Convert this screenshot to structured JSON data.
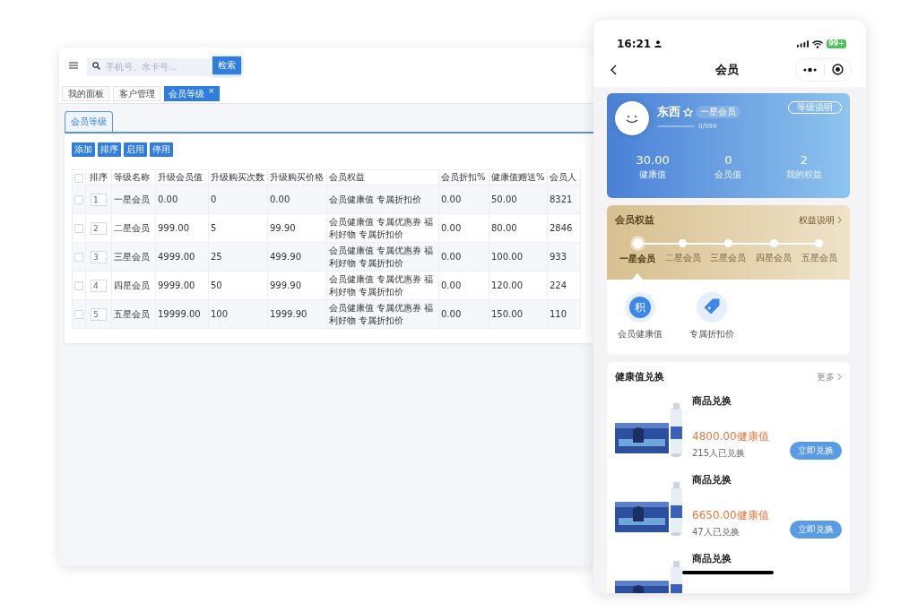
{
  "admin": {
    "search": {
      "placeholder": "手机号、水卡号...",
      "button": "检索"
    },
    "tabs": [
      {
        "label": "我的面板",
        "selected": false
      },
      {
        "label": "客户管理",
        "selected": false
      },
      {
        "label": "会员等级",
        "selected": true,
        "close": "×"
      }
    ],
    "sub_tabs": [
      {
        "label": "会员等级",
        "selected": true
      }
    ],
    "toolbar": [
      "添加",
      "排序",
      "启用",
      "停用"
    ],
    "table": {
      "header_checked": false,
      "columns": [
        "排序",
        "等级名称",
        "升级会员值",
        "升级购买次数",
        "升级购买价格",
        "会员权益",
        "会员折扣%",
        "健康值赠送%",
        "会员人"
      ],
      "rows": [
        {
          "checked": false,
          "cells": [
            "1",
            "一星会员",
            "0.00",
            "0",
            "0.00",
            "会员健康值 专属折扣价",
            "0.00",
            "50.00",
            "8321"
          ]
        },
        {
          "checked": false,
          "cells": [
            "2",
            "二星会员",
            "999.00",
            "5",
            "99.90",
            "会员健康值 专属优惠券 福利好物 专属折扣价",
            "0.00",
            "80.00",
            "2846"
          ]
        },
        {
          "checked": false,
          "cells": [
            "3",
            "三星会员",
            "4999.00",
            "25",
            "499.90",
            "会员健康值 专属优惠券 福利好物 专属折扣价",
            "0.00",
            "100.00",
            "933"
          ]
        },
        {
          "checked": false,
          "cells": [
            "4",
            "四星会员",
            "9999.00",
            "50",
            "999.90",
            "会员健康值 专属优惠券 福利好物 专属折扣价",
            "0.00",
            "120.00",
            "224"
          ]
        },
        {
          "checked": false,
          "cells": [
            "5",
            "五星会员",
            "19999.00",
            "100",
            "1999.90",
            "会员健康值 专属优惠券 福利好物 专属折扣价",
            "0.00",
            "150.00",
            "110"
          ]
        }
      ]
    }
  },
  "phone": {
    "status_bar": {
      "time": "16:21",
      "battery": "99+"
    },
    "nav": {
      "title": "会员"
    },
    "member_card": {
      "name": "东西",
      "badge": "一星会员",
      "progress": {
        "level": 0,
        "text": "0/999"
      },
      "button": "等级说明",
      "stats": [
        {
          "value": "30.00",
          "label": "健康值"
        },
        {
          "value": "0",
          "label": "会员值"
        },
        {
          "value": "2",
          "label": "我的权益"
        }
      ]
    },
    "benefits": {
      "title": "会员权益",
      "link": "权益说明",
      "levels": [
        {
          "label": "一星会员",
          "selected": true
        },
        {
          "label": "二星会员",
          "selected": false
        },
        {
          "label": "三星会员",
          "selected": false
        },
        {
          "label": "四星会员",
          "selected": false
        },
        {
          "label": "五星会员",
          "selected": false
        }
      ],
      "items": [
        {
          "kind": "glyph",
          "icon": "积",
          "label": "会员健康值"
        },
        {
          "kind": "tag",
          "label": "专属折扣价"
        }
      ]
    },
    "exchange": {
      "title": "健康值兑换",
      "more": "更多",
      "items": [
        {
          "title": "商品兑换",
          "price": "4800.00健康值",
          "count": "215人已兑换",
          "button": "立即兑换"
        },
        {
          "title": "商品兑换",
          "price": "6650.00健康值",
          "count": "47人已兑换",
          "button": "立即兑换"
        },
        {
          "title": "商品兑换"
        }
      ]
    }
  }
}
